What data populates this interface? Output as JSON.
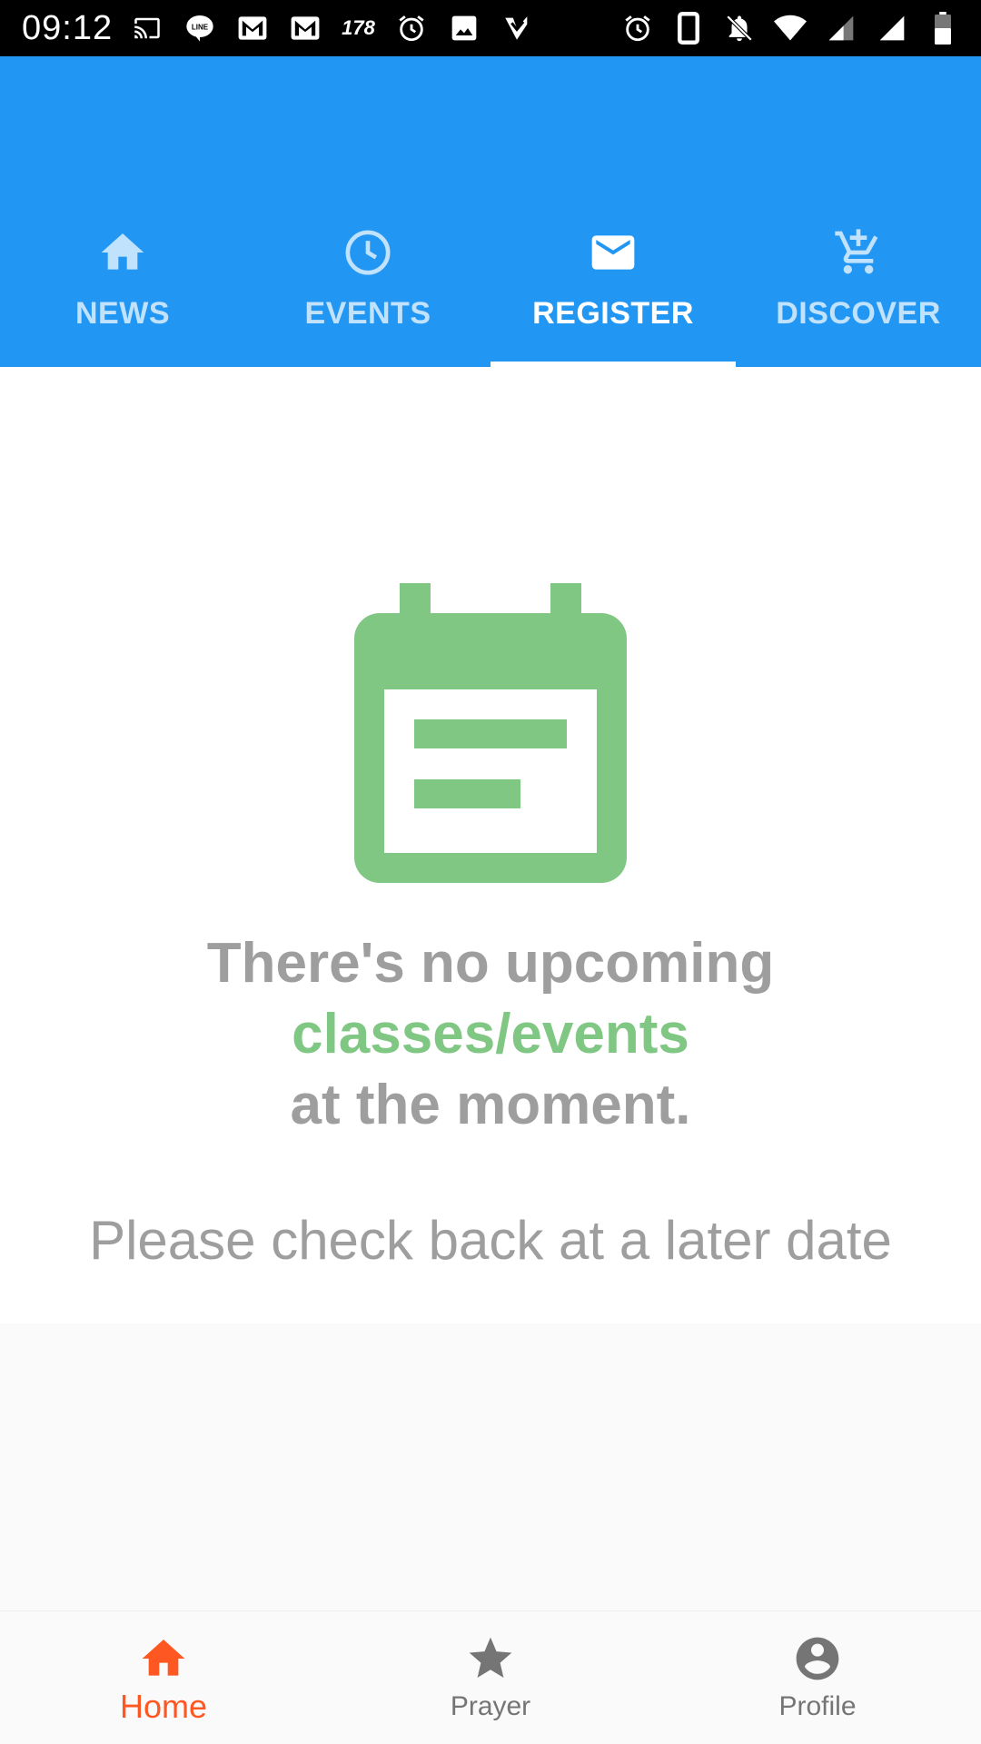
{
  "status_bar": {
    "time": "09:12",
    "badge_count": "178",
    "left_icons": [
      "cast-icon",
      "line-icon",
      "gmail-icon",
      "gmail-icon",
      "alarm-icon",
      "image-icon",
      "check-icon"
    ],
    "right_icons": [
      "alarm-icon",
      "phone-icon",
      "bell-off-icon",
      "wifi-icon",
      "signal-icon",
      "signal-icon",
      "battery-icon"
    ]
  },
  "tabs": [
    {
      "label": "NEWS",
      "icon": "home-icon",
      "active": false
    },
    {
      "label": "EVENTS",
      "icon": "clock-icon",
      "active": false
    },
    {
      "label": "REGISTER",
      "icon": "mail-icon",
      "active": true
    },
    {
      "label": "DISCOVER",
      "icon": "cart-plus-icon",
      "active": false
    }
  ],
  "empty_state": {
    "icon": "calendar-icon",
    "line1": "There's no upcoming",
    "line2": "classes/events",
    "line3": "at the moment.",
    "subtext": "Please check back at a later date"
  },
  "bottom_nav": [
    {
      "label": "Home",
      "icon": "home-icon",
      "active": true
    },
    {
      "label": "Prayer",
      "icon": "star-icon",
      "active": false
    },
    {
      "label": "Profile",
      "icon": "account-icon",
      "active": false
    }
  ],
  "colors": {
    "primary": "#2196f3",
    "accent_green": "#81c784",
    "text_gray": "#9e9e9e",
    "bottom_active": "#ff5722"
  }
}
